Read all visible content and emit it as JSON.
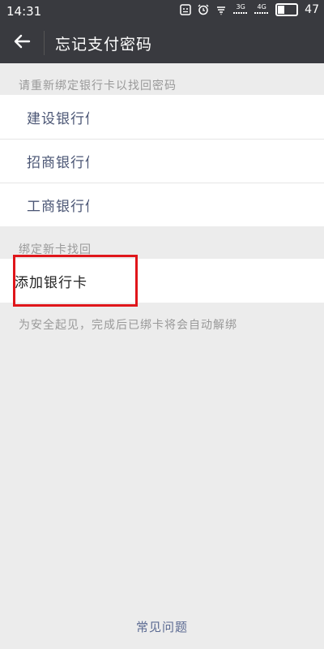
{
  "status_bar": {
    "time": "14:31",
    "icons": [
      "notification-icon",
      "alarm-icon",
      "wifi-icon",
      "signal-3g-icon",
      "signal-4g-icon"
    ],
    "network_3g": "3G",
    "network_4g": "4G",
    "battery_percent": "47",
    "battery_level": 0.47
  },
  "header": {
    "title": "忘记支付密码",
    "back_icon": "arrow-left-icon"
  },
  "rebind_section": {
    "label": "请重新绑定银行卡以找回密码",
    "banks": [
      {
        "label": "建设银行信"
      },
      {
        "label": "招商银行信"
      },
      {
        "label": "工商银行信"
      }
    ]
  },
  "new_card_section": {
    "label": "绑定新卡找回",
    "add_card_label": "添加银行卡",
    "note": "为安全起见，完成后已绑卡将会自动解绑"
  },
  "footer": {
    "faq_link": "常见问题"
  },
  "colors": {
    "header_bg": "#393a3f",
    "page_bg": "#ececec",
    "highlight": "#e0161b",
    "link": "#5b6a92"
  }
}
